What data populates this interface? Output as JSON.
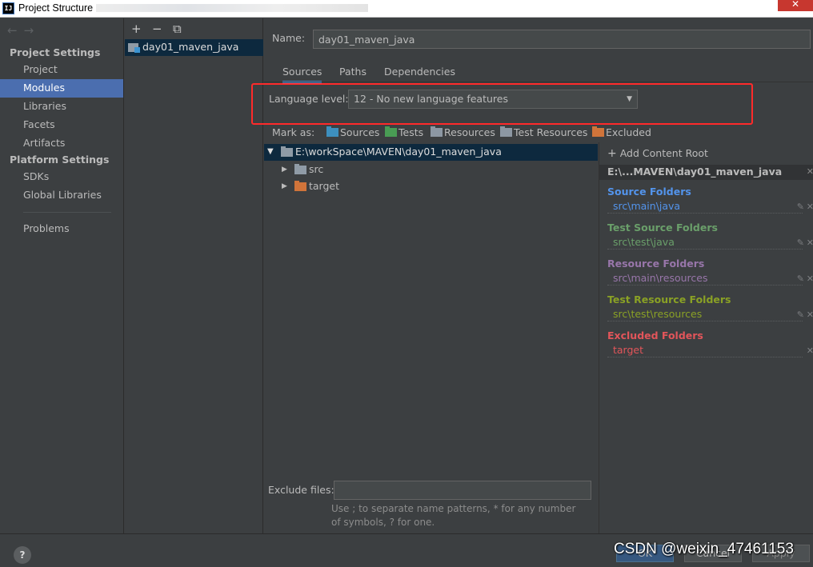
{
  "window": {
    "title": "Project Structure",
    "app_icon": "IJ"
  },
  "nav": {
    "project_settings_header": "Project Settings",
    "project_settings_items": [
      "Project",
      "Modules",
      "Libraries",
      "Facets",
      "Artifacts"
    ],
    "selected": "Modules",
    "platform_settings_header": "Platform Settings",
    "platform_settings_items": [
      "SDKs",
      "Global Libraries"
    ],
    "problems": "Problems"
  },
  "module_list": {
    "toolbar": {
      "add": "+",
      "remove": "−",
      "copy": "⧉"
    },
    "items": [
      "day01_maven_java"
    ]
  },
  "main": {
    "name_label": "Name:",
    "name_value": "day01_maven_java",
    "tabs": [
      "Sources",
      "Paths",
      "Dependencies"
    ],
    "active_tab": "Sources",
    "language_level_label": "Language level:",
    "language_level_value": "12 - No new language features",
    "mark_as_label": "Mark as:",
    "mark_as": [
      {
        "label": "Sources",
        "color": "#3d8fbe"
      },
      {
        "label": "Tests",
        "color": "#499c54"
      },
      {
        "label": "Resources",
        "color": "#8c97a3"
      },
      {
        "label": "Test Resources",
        "color": "#8c97a3"
      },
      {
        "label": "Excluded",
        "color": "#d0743a"
      }
    ],
    "tree": {
      "root": "E:\\workSpace\\MAVEN\\day01_maven_java",
      "children": [
        "src",
        "target"
      ]
    },
    "content_root": {
      "add_label": "Add Content Root",
      "path": "E:\\...MAVEN\\day01_maven_java",
      "groups": [
        {
          "header": "Source Folders",
          "path": "src\\main\\java",
          "color": "#5394ec"
        },
        {
          "header": "Test Source Folders",
          "path": "src\\test\\java",
          "color": "#6a9f6a"
        },
        {
          "header": "Resource Folders",
          "path": "src\\main\\resources",
          "color": "#9876aa"
        },
        {
          "header": "Test Resource Folders",
          "path": "src\\test\\resources",
          "color": "#8aa125"
        },
        {
          "header": "Excluded Folders",
          "path": "target",
          "color": "#e2555a"
        }
      ]
    },
    "exclude_files_label": "Exclude files:",
    "exclude_files_value": "",
    "exclude_hint": "Use ; to separate name patterns, * for any number of symbols, ? for one."
  },
  "footer": {
    "help": "?",
    "ok": "OK",
    "cancel": "Cancel",
    "apply": "Apply",
    "watermark": "CSDN @weixin_47461153"
  }
}
